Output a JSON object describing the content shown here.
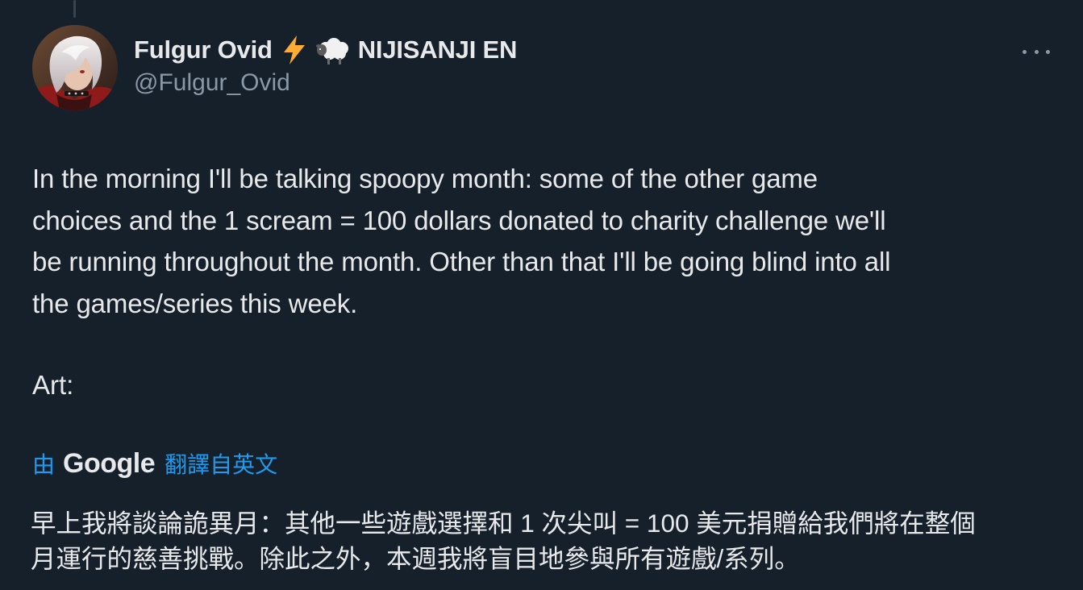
{
  "tweet": {
    "author": {
      "display_name": "Fulgur Ovid",
      "emoji": "⚡ 🐑",
      "org": "NIJISANJI EN",
      "handle": "@Fulgur_Ovid"
    },
    "more_icon": "more-horizontal-icon",
    "text_lines": [
      "In the morning I'll be talking spoopy month: some of the other game",
      "choices and the 1 scream = 100 dollars donated to charity challenge we'll",
      "be running throughout the month. Other than that I'll be going blind into all",
      "the games/series this week."
    ],
    "art_label": "Art:",
    "translation": {
      "by": "由",
      "provider": "Google",
      "from_label": "翻譯自英文",
      "lines": [
        "早上我將談論詭異月：其他一些遊戲選擇和 1 次尖叫 = 100 美元捐贈給我們將在整個",
        "月運行的慈善挑戰。除此之外，本週我將盲目地參與所有遊戲/系列。"
      ]
    },
    "colors": {
      "background": "#15202b",
      "text": "#e7e9ea",
      "secondary": "#8b98a5",
      "link": "#1d9bf0",
      "lightning": "#ffac33"
    }
  }
}
